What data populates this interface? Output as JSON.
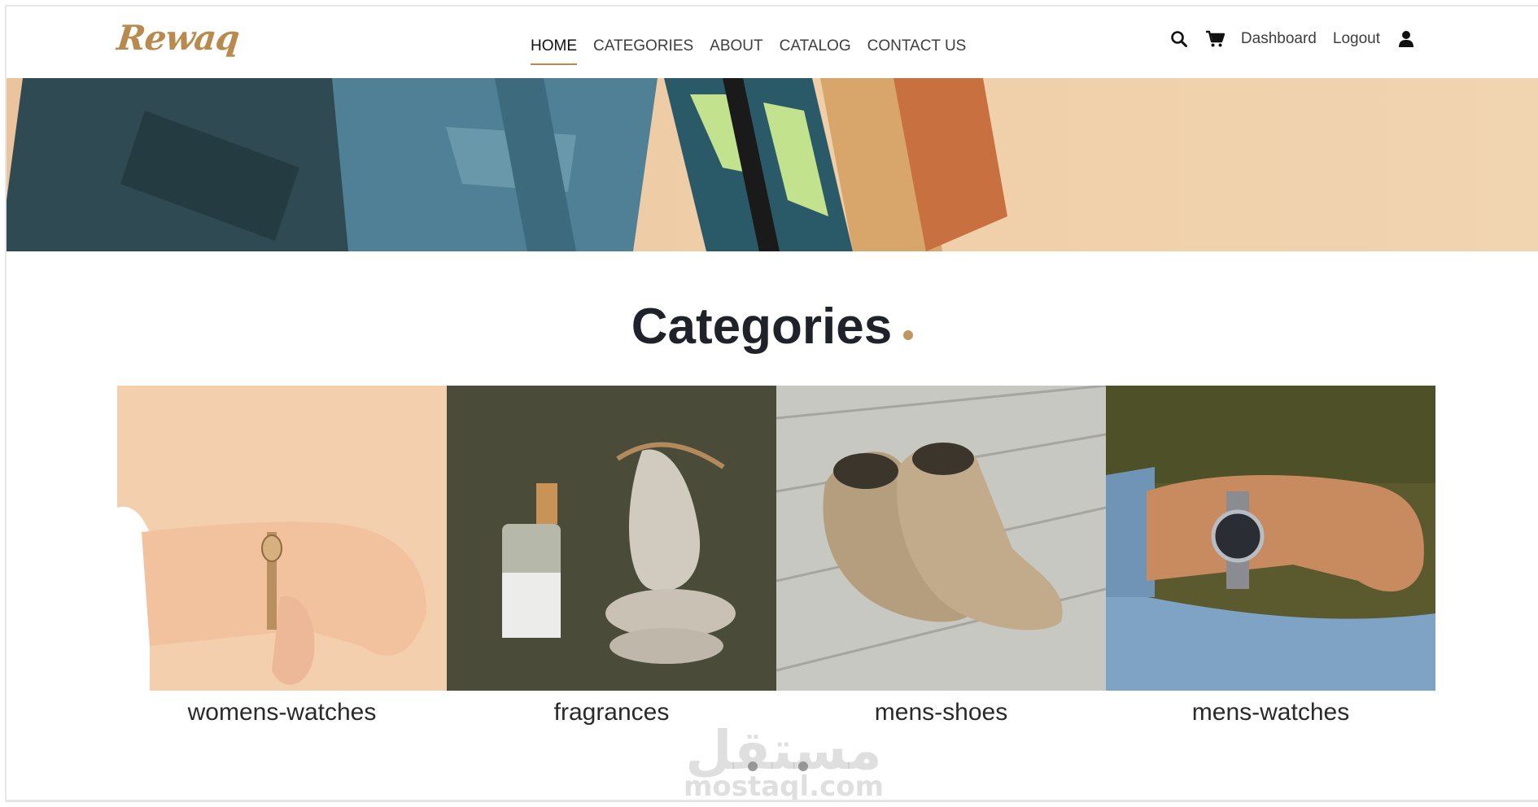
{
  "brand": {
    "logo_text": "Rewaq",
    "accent_color": "#b88a4e"
  },
  "nav": {
    "items": [
      {
        "label": "HOME",
        "active": true
      },
      {
        "label": "CATEGORIES",
        "active": false
      },
      {
        "label": "ABOUT",
        "active": false
      },
      {
        "label": "CATALOG",
        "active": false
      },
      {
        "label": "CONTACT US",
        "active": false
      }
    ]
  },
  "utils": {
    "search_icon": "search-icon",
    "cart_icon": "cart-icon",
    "dashboard_label": "Dashboard",
    "logout_label": "Logout",
    "user_icon": "user-icon"
  },
  "hero": {
    "image": "shopping-bags-banner"
  },
  "categories": {
    "title": "Categories",
    "items": [
      {
        "label": "womens-watches",
        "image": "womens-watch-photo"
      },
      {
        "label": "fragrances",
        "image": "perfume-bottle-photo"
      },
      {
        "label": "mens-shoes",
        "image": "suede-boots-photo"
      },
      {
        "label": "mens-watches",
        "image": "mens-watch-photo"
      }
    ],
    "carousel_pages": 2
  },
  "watermark": {
    "arabic": "مستقل",
    "latin": "mostaql.com"
  }
}
